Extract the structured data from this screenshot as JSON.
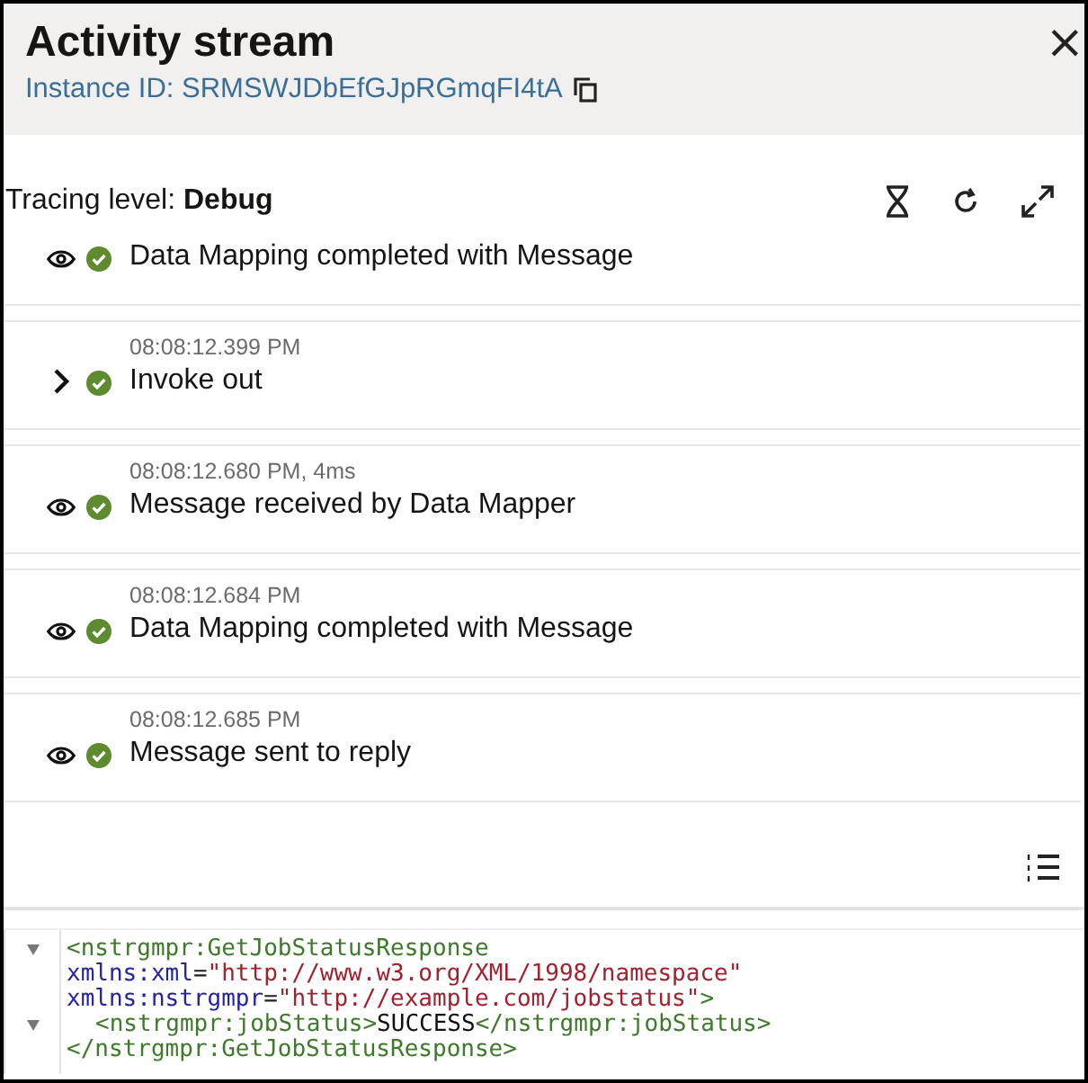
{
  "panel": {
    "title": "Activity stream",
    "instance_id": "Instance ID: SRMSWJDbEfGJpRGmqFI4tA",
    "close": "×"
  },
  "toolbar": {
    "label": "Tracing level: ",
    "level": "Debug"
  },
  "activities": [
    {
      "kind": "details",
      "message": "Data Mapping completed with Message"
    },
    {
      "kind": "expandable",
      "time": "08:08:12.399 PM",
      "message": "Invoke out"
    },
    {
      "kind": "details",
      "time": "08:08:12.680 PM, 4ms",
      "message": "Message received by Data Mapper"
    },
    {
      "kind": "details",
      "time": "08:08:12.684 PM",
      "message": "Data Mapping completed with Message"
    },
    {
      "kind": "details",
      "time": "08:08:12.685 PM",
      "message": "Message sent to reply"
    }
  ],
  "code": [
    {
      "foldable": true,
      "indented": false,
      "segments": [
        {
          "kind": "tag",
          "text": "<nstrgmpr:GetJobStatusResponse"
        }
      ]
    },
    {
      "foldable": false,
      "indented": false,
      "segments": [
        {
          "kind": "attr",
          "text": "xmlns:xml"
        },
        {
          "kind": "punct",
          "text": "="
        },
        {
          "kind": "value",
          "text": "\"http://www.w3.org/XML/1998/namespace\""
        }
      ]
    },
    {
      "foldable": false,
      "indented": false,
      "segments": [
        {
          "kind": "attr",
          "text": "xmlns:nstrgmpr"
        },
        {
          "kind": "punct",
          "text": "="
        },
        {
          "kind": "value",
          "text": "\"http://example.com/jobstatus\""
        },
        {
          "kind": "tag",
          "text": ">"
        }
      ]
    },
    {
      "foldable": true,
      "indented": true,
      "segments": [
        {
          "kind": "tag",
          "text": "<nstrgmpr:jobStatus>"
        },
        {
          "kind": "text",
          "text": "SUCCESS"
        },
        {
          "kind": "tag",
          "text": "</nstrgmpr:jobStatus>"
        }
      ]
    },
    {
      "foldable": false,
      "indented": false,
      "segments": [
        {
          "kind": "tag",
          "text": "</nstrgmpr:GetJobStatusResponse>"
        }
      ]
    }
  ]
}
